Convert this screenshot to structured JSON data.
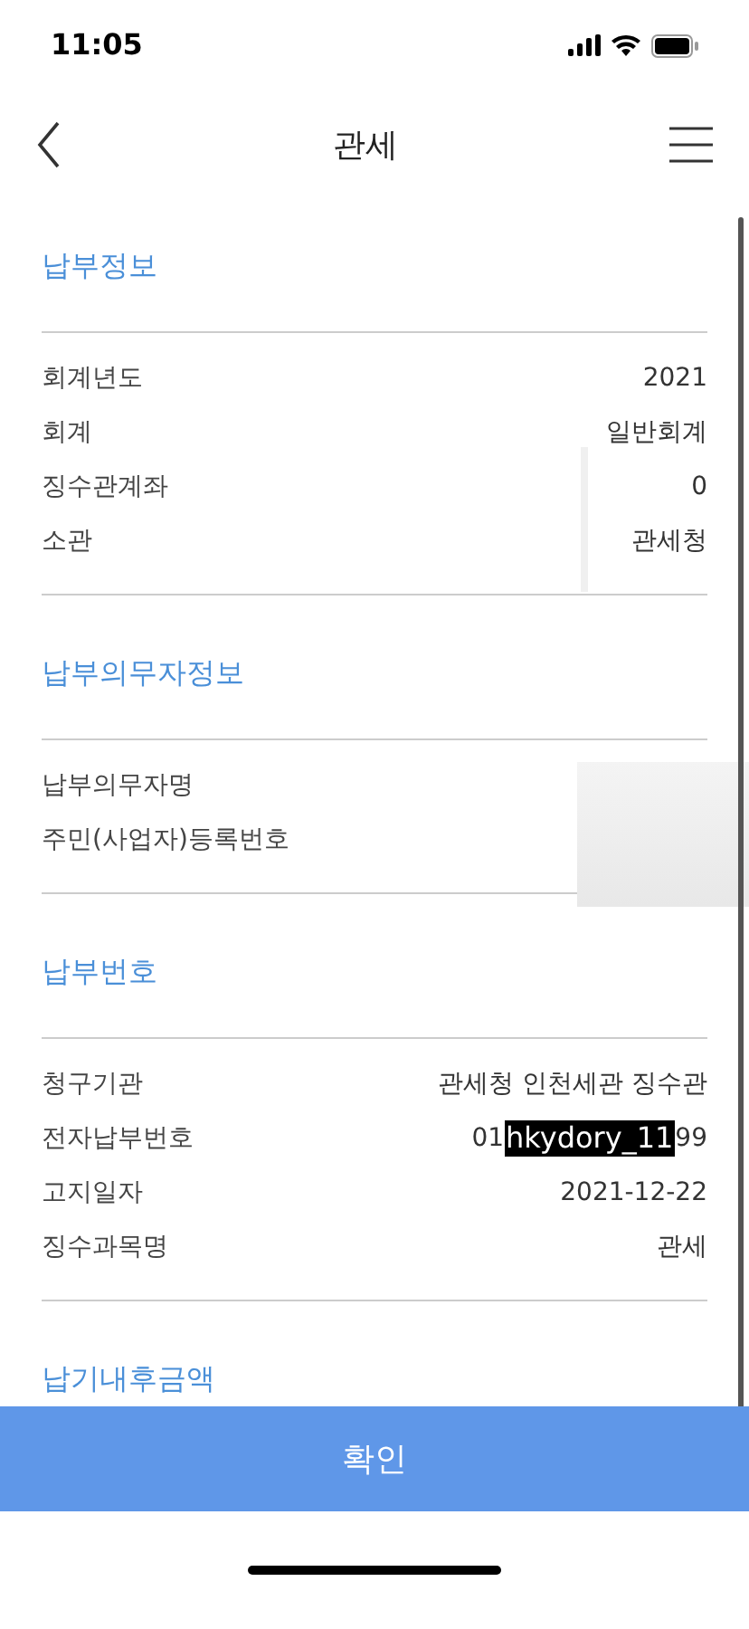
{
  "status_bar": {
    "time": "11:05"
  },
  "header": {
    "title": "관세"
  },
  "sections": [
    {
      "title": "납부정보",
      "redacted": true,
      "rows": [
        {
          "label": "회계년도",
          "value": "2021"
        },
        {
          "label": "회계",
          "value": "일반회계"
        },
        {
          "label": "징수관계좌",
          "value": "0"
        },
        {
          "label": "소관",
          "value": "관세청"
        }
      ]
    },
    {
      "title": "납부의무자정보",
      "redacted": true,
      "rows": [
        {
          "label": "납부의무자명"
        },
        {
          "label": "주민(사업자)등록번호"
        }
      ]
    },
    {
      "title": "납부번호",
      "redacted": false,
      "rows": [
        {
          "label": "청구기관",
          "value": "관세청 인천세관 징수관"
        },
        {
          "label": "전자납부번호",
          "value": "01",
          "tag": "hkydory_11",
          "value_end": "99"
        },
        {
          "label": "고지일자",
          "value": "2021-12-22"
        },
        {
          "label": "징수과목명",
          "value": "관세"
        }
      ]
    },
    {
      "title": "납기내후금액",
      "redacted": false
    }
  ],
  "confirm_button": "확인"
}
